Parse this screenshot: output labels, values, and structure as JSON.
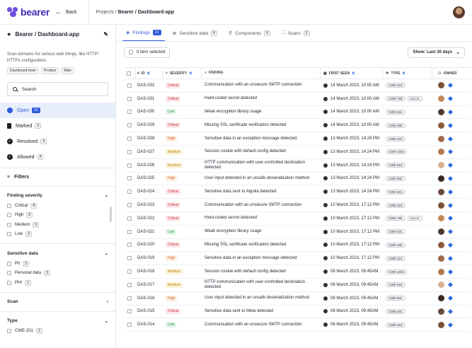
{
  "app": {
    "logo": "bearer",
    "back": "Back",
    "breadcrumb_prefix": "Projects / ",
    "breadcrumb_current": "Bearer / Dashboard-app"
  },
  "sidebar": {
    "project": "Bearer / Dashboard-app",
    "description": "Scan domains for various web things, like HTTP/ HTTPs configuration.",
    "tags": [
      "Dashboard team",
      "Product",
      "Main"
    ],
    "search_placeholder": "Search",
    "statuses": [
      {
        "label": "Open",
        "count": "21",
        "color": "#2e5bdc",
        "active": true
      },
      {
        "label": "Marked",
        "count": "3",
        "color": "#222",
        "active": false
      },
      {
        "label": "Resolved",
        "count": "4",
        "color": "#222",
        "active": false
      },
      {
        "label": "Allowed",
        "count": "4",
        "color": "#222",
        "active": false
      }
    ],
    "filters_label": "Filters",
    "finding_severity": {
      "title": "Finding severity",
      "items": [
        {
          "label": "Critical",
          "count": "8"
        },
        {
          "label": "High",
          "count": "6"
        },
        {
          "label": "Medium",
          "count": "5"
        },
        {
          "label": "Low",
          "count": "3"
        }
      ]
    },
    "sensitive_data": {
      "title": "Sensitive data",
      "items": [
        {
          "label": "PII",
          "count": "2"
        },
        {
          "label": "Personal data",
          "count": "3"
        },
        {
          "label": "PHI",
          "count": "1"
        }
      ]
    },
    "scan": {
      "title": "Scan"
    },
    "type": {
      "title": "Type",
      "items": [
        {
          "label": "CWE-201",
          "count": "2"
        }
      ]
    }
  },
  "tabs": [
    {
      "label": "Findings",
      "count": "21",
      "icon": "shield-icon",
      "active": true
    },
    {
      "label": "Sensitive data",
      "count": "6",
      "icon": "database-icon",
      "active": false
    },
    {
      "label": "Components",
      "count": "6",
      "icon": "component-icon",
      "active": false
    },
    {
      "label": "Scans",
      "count": "2",
      "icon": "scan-icon",
      "active": false
    }
  ],
  "toolbar": {
    "selected": "0 item selected",
    "show": "Show: Last 30 days"
  },
  "columns": {
    "id": "ID",
    "severity": "SEVERITY",
    "finding": "FINDING",
    "first_seen": "FIRST SEEN",
    "type": "TYPE",
    "owner": "OWNER"
  },
  "rows": [
    {
      "id": "DAS-032",
      "severity": "Critical",
      "finding": "Communication with an unsecure SMTP connection",
      "first_seen": "14 March 2023, 10:00 AM",
      "type": "CWE-319",
      "extra": "",
      "avatar": "#7a5236"
    },
    {
      "id": "DAS-031",
      "severity": "Critical",
      "finding": "Hard-coded secret detected",
      "first_seen": "14 March 2023, 10:00 AM",
      "type": "CWE-798",
      "extra": "Secret",
      "avatar": "#c48a5a"
    },
    {
      "id": "DAS-030",
      "severity": "Low",
      "finding": "Weak encryption library usage",
      "first_seen": "14 March 2023, 10:00 AM",
      "type": "CWE-331",
      "extra": "",
      "avatar": "#4b3a2f"
    },
    {
      "id": "DAS-029",
      "severity": "Critical",
      "finding": "Missing SSL certificate verification detected",
      "first_seen": "14 March 2023, 10:00 AM",
      "type": "CWE-295",
      "extra": "",
      "avatar": "#8a5a3c"
    },
    {
      "id": "DAS-028",
      "severity": "High",
      "finding": "Sensitive data in an exception message detected",
      "first_seen": "13 March 2023, 14:24 PM",
      "type": "CWE-210",
      "extra": "",
      "avatar": "#a06a4a"
    },
    {
      "id": "DAS-027",
      "severity": "Medium",
      "finding": "Session cookie with default config detected",
      "first_seen": "13 March 2023, 14:24 PM",
      "type": "CWE-1004",
      "extra": "",
      "avatar": "#b07850"
    },
    {
      "id": "DAS-026",
      "severity": "Medium",
      "finding": "HTTP communication with user-controlled destination detected",
      "first_seen": "13 March 2023, 14:24 PM",
      "type": "CWE-918",
      "extra": "",
      "avatar": "#d8b090"
    },
    {
      "id": "DAS-025",
      "severity": "High",
      "finding": "User input detected in an unsafe deserialization method",
      "first_seen": "13 March 2023, 14:24 PM",
      "type": "CWE-502",
      "extra": "",
      "avatar": "#3a2a22"
    },
    {
      "id": "DAS-024",
      "severity": "Critical",
      "finding": "Sensitive data sent to Algolia detected",
      "first_seen": "13 March 2023, 14:24 PM",
      "type": "CWE-201",
      "extra": "",
      "avatar": "#6a4a3a"
    },
    {
      "id": "DAS-023",
      "severity": "Critical",
      "finding": "Communication with an unsecure SMTP connection",
      "first_seen": "10 March 2023, 17:12 PM",
      "type": "CWE-319",
      "extra": "",
      "avatar": "#7a5236"
    },
    {
      "id": "DAS-022",
      "severity": "Critical",
      "finding": "Hard-coded secret detected",
      "first_seen": "10 March 2023, 17:12 PM",
      "type": "CWE-798",
      "extra": "Secret",
      "avatar": "#c48a5a"
    },
    {
      "id": "DAS-021",
      "severity": "Low",
      "finding": "Weak encryption library usage",
      "first_seen": "10 March 2023, 17:12 PM",
      "type": "CWE-331",
      "extra": "",
      "avatar": "#4b3a2f"
    },
    {
      "id": "DAS-020",
      "severity": "Critical",
      "finding": "Missing SSL certificate verification detected",
      "first_seen": "10 March 2023, 17:12 PM",
      "type": "CWE-295",
      "extra": "",
      "avatar": "#8a5a3c"
    },
    {
      "id": "DAS-019",
      "severity": "High",
      "finding": "Sensitive data in an exception message detected",
      "first_seen": "10 March 2023, 17:12 PM",
      "type": "CWE-210",
      "extra": "",
      "avatar": "#a06a4a"
    },
    {
      "id": "DAS-018",
      "severity": "Medium",
      "finding": "Session cookie with default config detected",
      "first_seen": "08 March 2023, 09:45AM",
      "type": "CWE-1004",
      "extra": "",
      "avatar": "#b07850"
    },
    {
      "id": "DAS-017",
      "severity": "Medium",
      "finding": "HTTP communication with user-controlled destination detected",
      "first_seen": "08 March 2023, 09:45AM",
      "type": "CWE-918",
      "extra": "",
      "avatar": "#d8b090"
    },
    {
      "id": "DAS-016",
      "severity": "High",
      "finding": "User input detected in an unsafe deserialization method",
      "first_seen": "08 March 2023, 09:45AM",
      "type": "CWE-502",
      "extra": "",
      "avatar": "#3a2a22"
    },
    {
      "id": "DAS-015",
      "severity": "Critical",
      "finding": "Sensitive data sent to Meta detected",
      "first_seen": "08 March 2023, 09:45AM",
      "type": "CWE-201",
      "extra": "",
      "avatar": "#6a4a3a"
    },
    {
      "id": "DAS-014",
      "severity": "Low",
      "finding": "Communication with an unsecure SMTP connection",
      "first_seen": "08 March 2023, 09:45AM",
      "type": "CWE-319",
      "extra": "",
      "avatar": "#7a5236"
    }
  ]
}
